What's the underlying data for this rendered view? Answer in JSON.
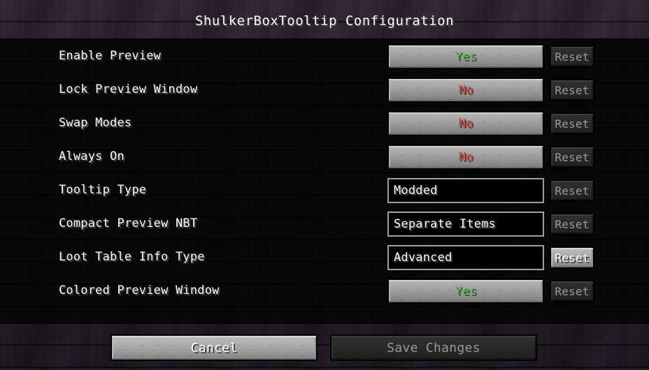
{
  "window": {
    "title": "ShulkerBoxTooltip Configuration"
  },
  "options": [
    {
      "label": "Enable Preview",
      "control_type": "toggle",
      "value": "Yes",
      "value_state": "yes",
      "reset_label": "Reset",
      "reset_enabled": false
    },
    {
      "label": "Lock Preview Window",
      "control_type": "toggle",
      "value": "No",
      "value_state": "no",
      "reset_label": "Reset",
      "reset_enabled": false
    },
    {
      "label": "Swap Modes",
      "control_type": "toggle",
      "value": "No",
      "value_state": "no",
      "reset_label": "Reset",
      "reset_enabled": false
    },
    {
      "label": "Always On",
      "control_type": "toggle",
      "value": "No",
      "value_state": "no",
      "reset_label": "Reset",
      "reset_enabled": false
    },
    {
      "label": "Tooltip Type",
      "control_type": "field",
      "value": "Modded",
      "value_state": "text",
      "reset_label": "Reset",
      "reset_enabled": false
    },
    {
      "label": "Compact Preview NBT",
      "control_type": "field",
      "value": "Separate Items",
      "value_state": "text",
      "reset_label": "Reset",
      "reset_enabled": false
    },
    {
      "label": "Loot Table Info Type",
      "control_type": "field",
      "value": "Advanced",
      "value_state": "text",
      "reset_label": "Reset",
      "reset_enabled": true
    },
    {
      "label": "Colored Preview Window",
      "control_type": "toggle",
      "value": "Yes",
      "value_state": "yes",
      "reset_label": "Reset",
      "reset_enabled": false
    }
  ],
  "footer": {
    "cancel_label": "Cancel",
    "save_label": "Save Changes",
    "cancel_enabled": true,
    "save_enabled": false
  },
  "colors": {
    "value_yes": "#3ec43e",
    "value_no": "#e23f3f",
    "text": "#ffffff",
    "text_disabled": "#9a9a9a",
    "background": "#2b1f2e"
  }
}
